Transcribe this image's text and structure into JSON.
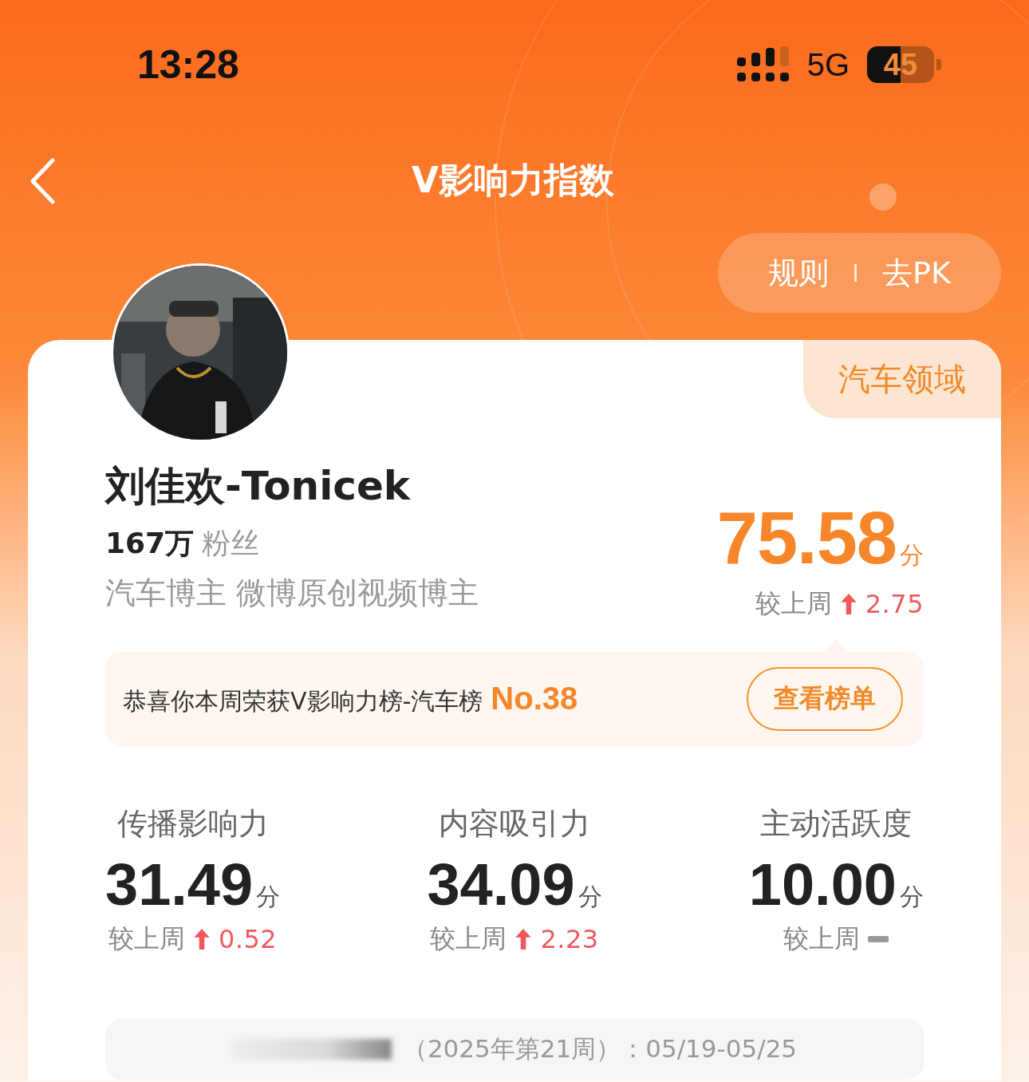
{
  "status_bar": {
    "time": "13:28",
    "network": "5G",
    "battery": "45"
  },
  "header": {
    "title": "V影响力指数"
  },
  "actions": [
    {
      "label": "规则"
    },
    {
      "label": "去PK"
    }
  ],
  "profile": {
    "domain_tag": "汽车领域",
    "name": "刘佳欢-Tonicek",
    "fans_count": "167万",
    "fans_label": "粉丝",
    "tags": "汽车博主 微博原创视频博主"
  },
  "score": {
    "value": "75.58",
    "unit": "分",
    "compare_label": "较上周",
    "kind": "rising",
    "change": "2.75"
  },
  "rank_banner": {
    "text": "恭喜你本周荣获V影响力榜-汽车榜",
    "rank": "No.38",
    "button": "查看榜单"
  },
  "metrics": [
    {
      "label": "传播影响力",
      "value": "31.49",
      "unit": "分",
      "compare_label": "较上周",
      "kind": "rising",
      "change": "0.52"
    },
    {
      "label": "内容吸引力",
      "value": "34.09",
      "unit": "分",
      "compare_label": "较上周",
      "kind": "rising",
      "change": "2.23"
    },
    {
      "label": "主动活跃度",
      "value": "10.00",
      "unit": "分",
      "compare_label": "较上周",
      "kind": "unchanged"
    }
  ],
  "period": {
    "text": "（2025年第21周）：05/19-05/25"
  }
}
